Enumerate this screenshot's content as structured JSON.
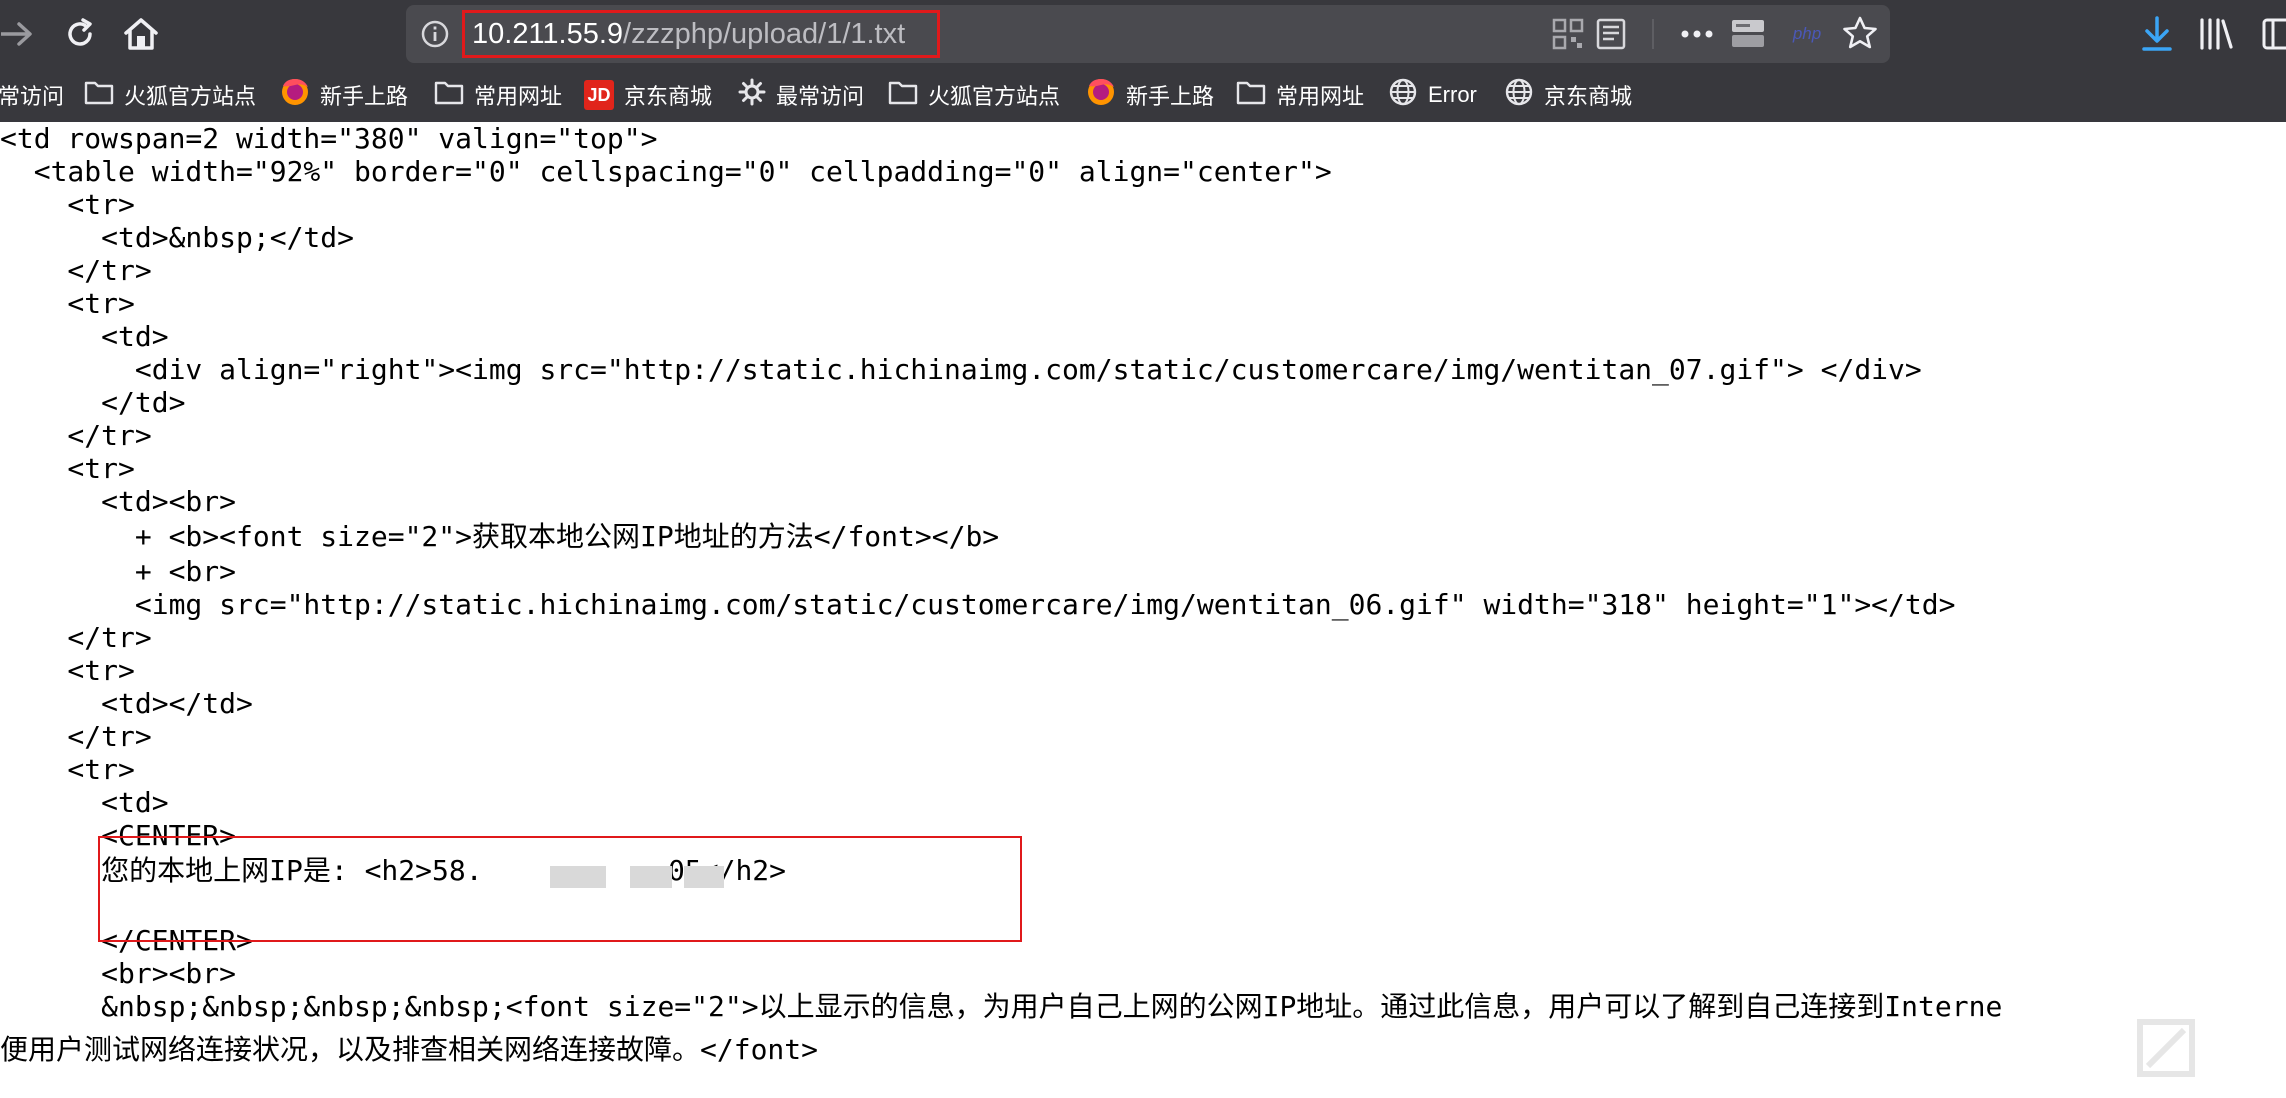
{
  "browser": {
    "url_host": "10.211.55.9",
    "url_path": "/zzzphp/upload/1/1.txt",
    "php_badge": "php"
  },
  "bookmarks": [
    {
      "label": "常访问",
      "icon": "none"
    },
    {
      "label": "火狐官方站点",
      "icon": "folder-icon"
    },
    {
      "label": "新手上路",
      "icon": "firefox-icon"
    },
    {
      "label": "常用网址",
      "icon": "folder-icon"
    },
    {
      "label": "京东商城",
      "icon": "jd-icon"
    },
    {
      "label": "最常访问",
      "icon": "gear-icon"
    },
    {
      "label": "火狐官方站点",
      "icon": "folder-icon"
    },
    {
      "label": "新手上路",
      "icon": "firefox-icon"
    },
    {
      "label": "常用网址",
      "icon": "folder-icon"
    },
    {
      "label": "Error",
      "icon": "globe-icon"
    },
    {
      "label": "京东商城",
      "icon": "globe-icon"
    }
  ],
  "jd_text": "JD",
  "source_lines": [
    "<td rowspan=2 width=\"380\" valign=\"top\">",
    "  <table width=\"92%\" border=\"0\" cellspacing=\"0\" cellpadding=\"0\" align=\"center\">",
    "    <tr>",
    "      <td>&nbsp;</td>",
    "    </tr>",
    "    <tr>",
    "      <td>",
    "        <div align=\"right\"><img src=\"http://static.hichinaimg.com/static/customercare/img/wentitan_07.gif\"> </div>",
    "      </td>",
    "    </tr>",
    "    <tr>",
    "      <td><br>",
    "        + <b><font size=\"2\">获取本地公网IP地址的方法</font></b>",
    "        + <br>",
    "        <img src=\"http://static.hichinaimg.com/static/customercare/img/wentitan_06.gif\" width=\"318\" height=\"1\"></td>",
    "    </tr>",
    "    <tr>",
    "      <td></td>",
    "    </tr>",
    "    <tr>",
    "      <td>",
    "      <CENTER>",
    "      您的本地上网IP是: <h2>58.           05</h2>",
    "",
    "      </CENTER>",
    "      <br><br>",
    "      &nbsp;&nbsp;&nbsp;&nbsp;<font size=\"2\">以上显示的信息，为用户自己上网的公网IP地址。通过此信息，用户可以了解到自己连接到Interne",
    "便用户测试网络连接状况，以及排查相关网络连接故障。</font>"
  ]
}
